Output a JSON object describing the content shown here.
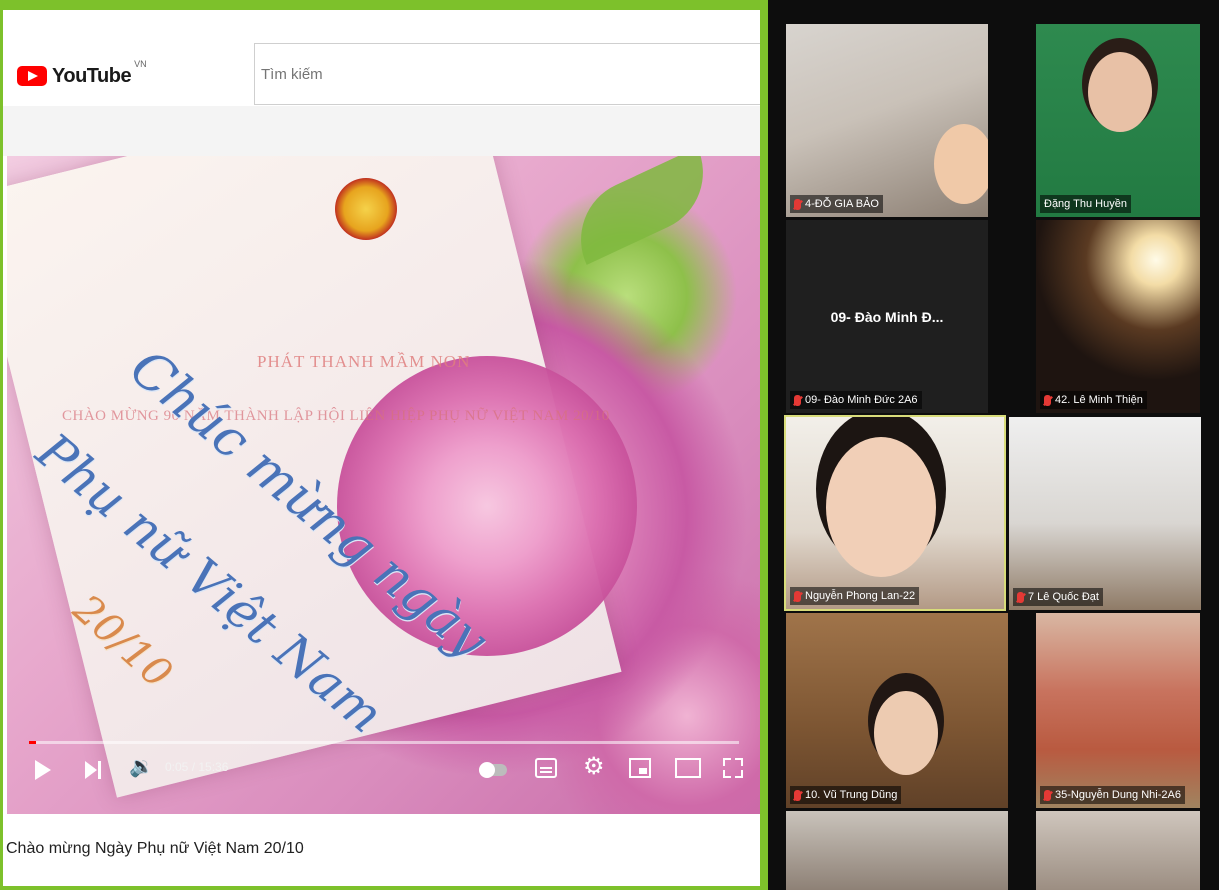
{
  "youtube": {
    "logo_text": "YouTube",
    "region": "VN",
    "search_placeholder": "Tìm kiếm",
    "player": {
      "overlay_title": "PHÁT THANH MẦM NON",
      "overlay_subtitle": "CHÀO MỪNG 90 NĂM THÀNH LẬP HỘI LIÊN HIỆP PHỤ NỮ VIỆT NAM 20/10",
      "script_line1": "Chúc mừng ngày",
      "script_line2": "Phụ nữ Việt Nam",
      "script_line3": "20/10",
      "time": "0:05 / 15:36",
      "progress": 0.0053
    },
    "video_title": "Chào mừng Ngày Phụ nữ Việt Nam 20/10"
  },
  "gallery": {
    "participants": [
      {
        "name": "4-ĐỖ GIA BẢO",
        "muted": true
      },
      {
        "name": "Đặng Thu Huyền",
        "muted": false
      },
      {
        "name": "09- Đào Minh Đức 2A6",
        "muted": true,
        "center_name": "09- Đào Minh Đ..."
      },
      {
        "name": "42. Lê Minh Thiện",
        "muted": true
      },
      {
        "name": "Nguyễn Phong Lan-22",
        "muted": true,
        "active_speaker": true
      },
      {
        "name": "7 Lê Quốc Đạt",
        "muted": true
      },
      {
        "name": "10. Vũ Trung Dũng",
        "muted": true
      },
      {
        "name": "35-Nguyễn Dung Nhi-2A6",
        "muted": true
      }
    ]
  },
  "colors": {
    "share_border": "#7dc12b",
    "youtube_red": "#ff0000",
    "active_speaker_border": "#d8dc7a",
    "muted_red": "#e53935"
  },
  "icons": [
    "play-icon",
    "next-icon",
    "volume-icon",
    "autoplay-toggle-icon",
    "captions-icon",
    "settings-gear-icon",
    "miniplayer-icon",
    "theater-mode-icon",
    "fullscreen-icon",
    "mic-muted-icon"
  ]
}
